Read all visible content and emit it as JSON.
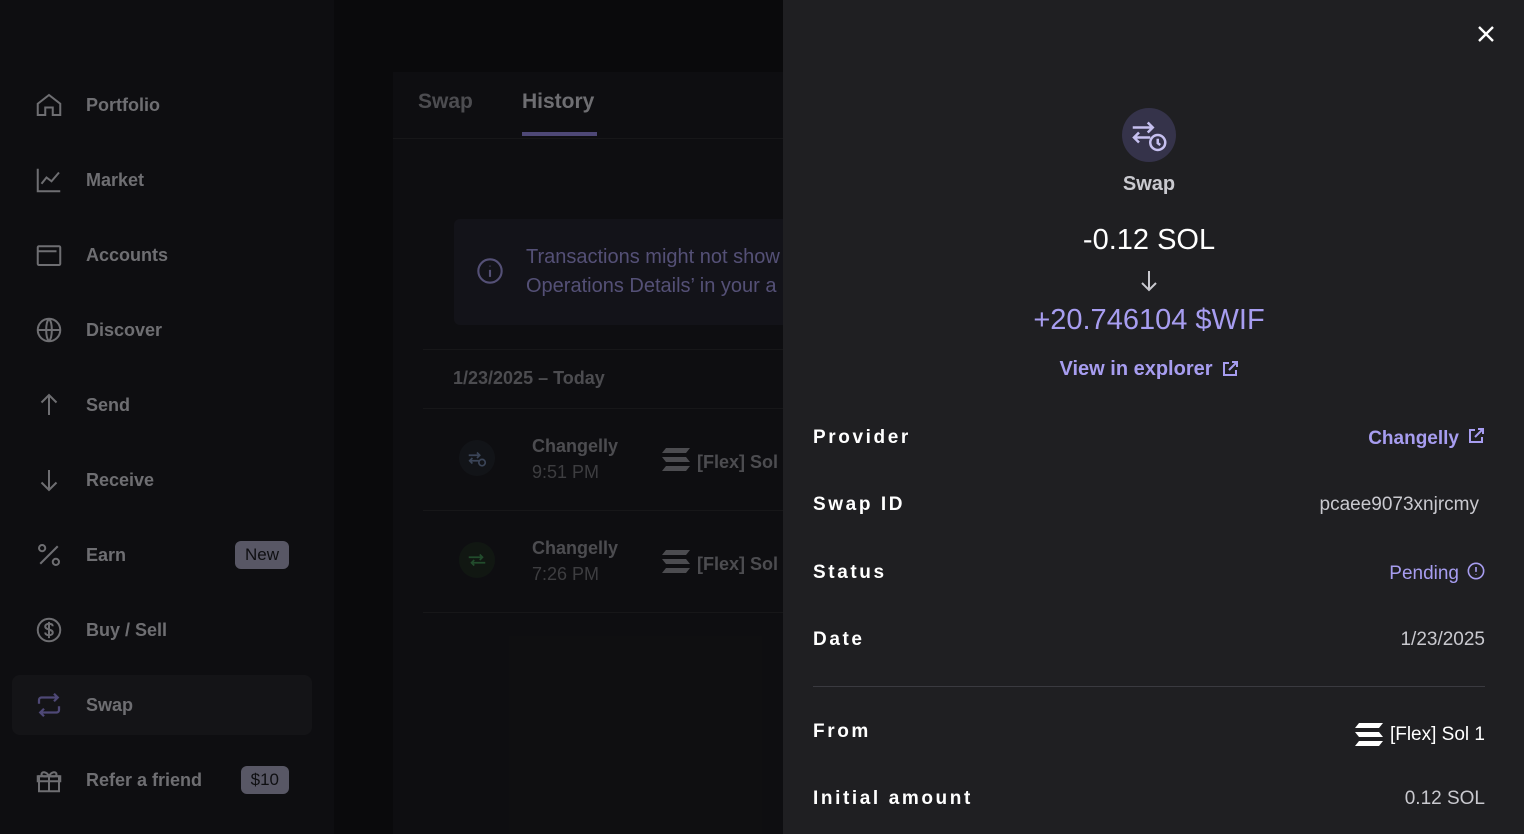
{
  "sidebar": {
    "items": [
      {
        "label": "Portfolio",
        "icon": "home-icon"
      },
      {
        "label": "Market",
        "icon": "chart-line-icon"
      },
      {
        "label": "Accounts",
        "icon": "wallet-icon"
      },
      {
        "label": "Discover",
        "icon": "globe-icon"
      },
      {
        "label": "Send",
        "icon": "arrow-up-icon"
      },
      {
        "label": "Receive",
        "icon": "arrow-down-icon"
      },
      {
        "label": "Earn",
        "icon": "percent-icon",
        "badge": "New"
      },
      {
        "label": "Buy / Sell",
        "icon": "dollar-circle-icon"
      },
      {
        "label": "Swap",
        "icon": "swap-icon",
        "active": true
      },
      {
        "label": "Refer a friend",
        "icon": "gift-icon",
        "badge": "$10"
      }
    ]
  },
  "main": {
    "tabs": [
      {
        "label": "Swap"
      },
      {
        "label": "History",
        "active": true
      }
    ],
    "info_banner": {
      "line1": "Transactions might not show",
      "line2": "Operations Details’ in your a"
    },
    "date_group": "1/23/2025 – Today",
    "operations": [
      {
        "provider": "Changelly",
        "time": "9:51 PM",
        "account": "[Flex] Sol",
        "status": "pending"
      },
      {
        "provider": "Changelly",
        "time": "7:26 PM",
        "account": "[Flex] Sol",
        "status": "done"
      }
    ]
  },
  "drawer": {
    "title": "Swap",
    "amount_from": "-0.12 SOL",
    "amount_to": "+20.746104 $WIF",
    "explorer_link": "View in explorer",
    "details": {
      "provider_label": "Provider",
      "provider_value": "Changelly",
      "swap_id_label": "Swap ID",
      "swap_id_value": "pcaee9073xnjrcmy",
      "status_label": "Status",
      "status_value": "Pending",
      "date_label": "Date",
      "date_value": "1/23/2025",
      "from_label": "From",
      "from_value": "[Flex] Sol 1",
      "initial_amount_label": "Initial amount",
      "initial_amount_value": "0.12 SOL"
    }
  },
  "colors": {
    "accent": "#a79df0",
    "drawer_bg": "#1f1f22",
    "sidebar_bg": "#1b1b1f"
  }
}
